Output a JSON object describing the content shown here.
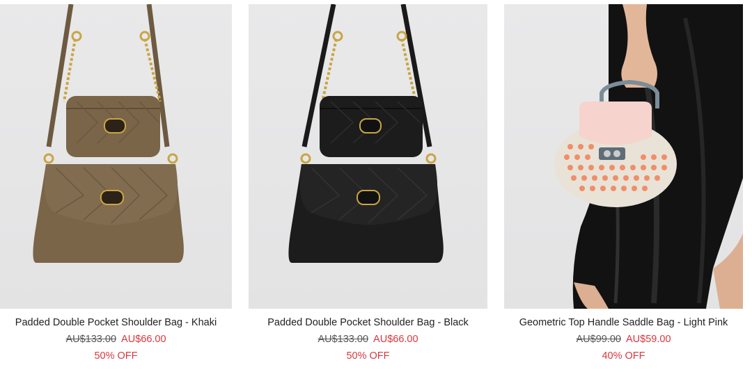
{
  "products": [
    {
      "name": "Padded Double Pocket Shoulder Bag - Khaki",
      "old_price": "AU$133.00",
      "new_price": "AU$66.00",
      "discount": "50% OFF",
      "bag_color": "#7a6549"
    },
    {
      "name": "Padded Double Pocket Shoulder Bag - Black",
      "old_price": "AU$133.00",
      "new_price": "AU$66.00",
      "discount": "50% OFF",
      "bag_color": "#1c1c1c"
    },
    {
      "name": "Geometric Top Handle Saddle Bag - Light Pink",
      "old_price": "AU$99.00",
      "new_price": "AU$59.00",
      "discount": "40% OFF",
      "bag_color": "#f6d3cc"
    }
  ],
  "colors": {
    "sale": "#d9363e",
    "text": "#222222",
    "strike": "#555555"
  }
}
